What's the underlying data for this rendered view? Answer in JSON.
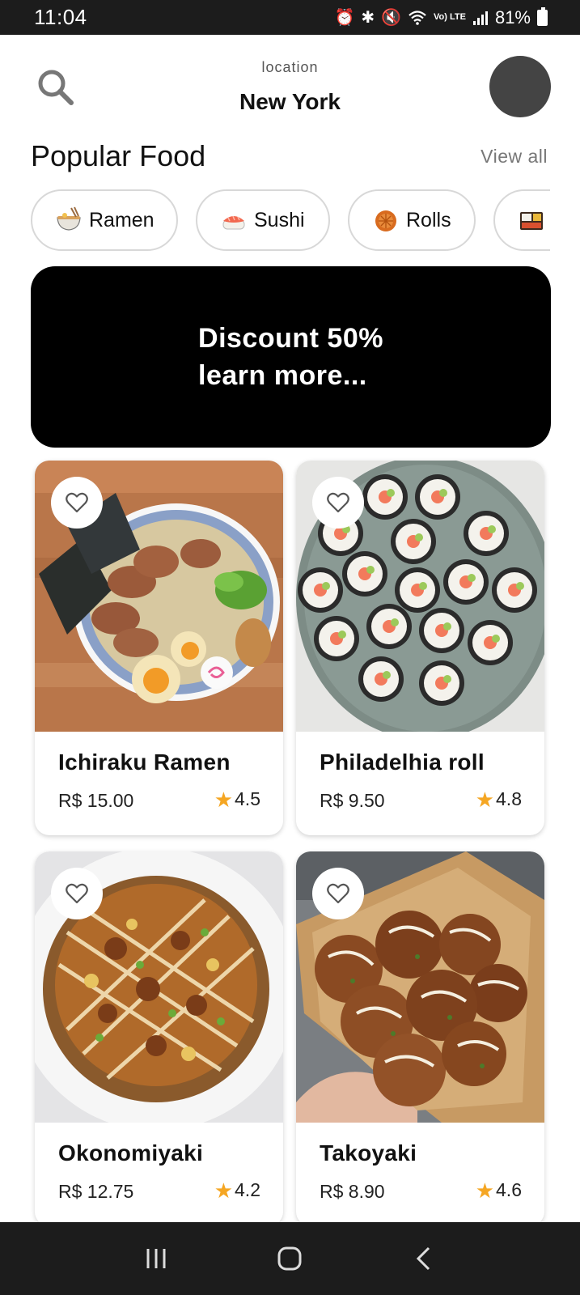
{
  "status_bar": {
    "time": "11:04",
    "battery": "81%",
    "network": "Vo) LTE"
  },
  "header": {
    "location_label": "location",
    "location_value": "New York"
  },
  "section": {
    "title": "Popular Food",
    "view_all": "View all"
  },
  "categories": [
    {
      "label": "Ramen",
      "icon": "ramen-bowl-emoji"
    },
    {
      "label": "Sushi",
      "icon": "sushi-emoji"
    },
    {
      "label": "Rolls",
      "icon": "moon-cake-emoji"
    },
    {
      "label": "",
      "icon": "bento-box-emoji"
    }
  ],
  "banner": {
    "line1": "Discount 50%",
    "line2": "learn more..."
  },
  "foods": [
    {
      "name": "Ichiraku Ramen",
      "price": "R$ 15.00",
      "rating": "4.5"
    },
    {
      "name": "Philadelhia roll",
      "price": "R$ 9.50",
      "rating": "4.8"
    },
    {
      "name": "Okonomiyaki",
      "price": "R$ 12.75",
      "rating": "4.2"
    },
    {
      "name": "Takoyaki",
      "price": "R$ 8.90",
      "rating": "4.6"
    }
  ],
  "icons": {
    "search": "search-icon",
    "favorite": "heart-outline-icon",
    "star": "star-icon",
    "nav_recent": "recent-apps-icon",
    "nav_home": "home-icon",
    "nav_back": "back-icon"
  },
  "colors": {
    "accent_star": "#f5a623",
    "banner_bg": "#000000",
    "avatar": "#444444"
  }
}
